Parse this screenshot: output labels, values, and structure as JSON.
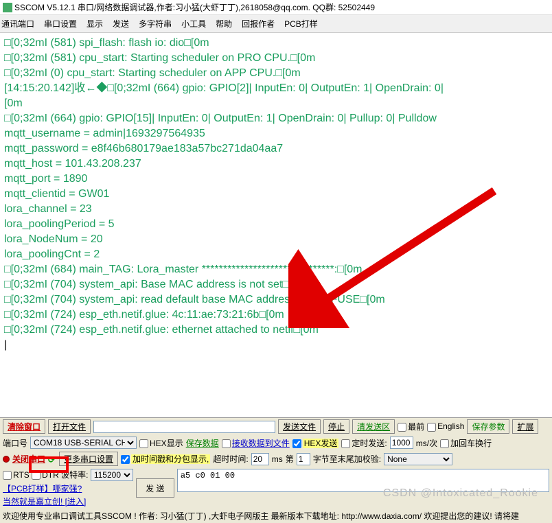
{
  "title": "SSCOM V5.12.1 串口/网络数据调试器,作者:习小猛(大虾丁丁),2618058@qq.com. QQ群: 52502449",
  "menu": [
    "通讯端口",
    "串口设置",
    "显示",
    "发送",
    "多字符串",
    "小工具",
    "帮助",
    "回报作者",
    "PCB打样"
  ],
  "log": [
    {
      "t": "□[0;32mI (581) spi_flash: flash io: dio□[0m"
    },
    {
      "t": "□[0;32mI (581) cpu_start: Starting scheduler on PRO CPU.□[0m"
    },
    {
      "t": "□[0;32mI (0) cpu_start: Starting scheduler on APP CPU.□[0m"
    },
    {
      "t": ""
    },
    {
      "t": "[14:15:20.142]收←◆□[0;32mI (664) gpio: GPIO[2]| InputEn: 0| OutputEn: 1| OpenDrain: 0|"
    },
    {
      "t": "[0m"
    },
    {
      "t": "□[0;32mI (664) gpio: GPIO[15]| InputEn: 0| OutputEn: 1| OpenDrain: 0| Pullup: 0| Pulldow"
    },
    {
      "t": "mqtt_username = admin|1693297564935"
    },
    {
      "t": "mqtt_password = e8f46b680179ae183a57bc271da04aa7"
    },
    {
      "t": "mqtt_host = 101.43.208.237"
    },
    {
      "t": "mqtt_port = 1890"
    },
    {
      "t": "mqtt_clientid = GW01"
    },
    {
      "t": "lora_channel = 23"
    },
    {
      "t": "lora_poolingPeriod = 5"
    },
    {
      "t": "lora_NodeNum = 20"
    },
    {
      "t": "lora_poolingCnt = 2"
    },
    {
      "t": "□[0;32mI (684) main_TAG: Lora_master *******************************:□[0m"
    },
    {
      "t": "□[0;32mI (704) system_api: Base MAC address is not set□[0m"
    },
    {
      "t": "□[0;32mI (704) system_api: read default base MAC address from EFUSE□[0m"
    },
    {
      "t": "□[0;32mI (724) esp_eth.netif.glue: 4c:11:ae:73:21:6b□[0m"
    },
    {
      "t": "□[0;32mI (724) esp_eth.netif.glue: ethernet attached to netif□[0m"
    }
  ],
  "bottom": {
    "clear": "清除窗口",
    "open_file": "打开文件",
    "send_file": "发送文件",
    "stop": "停止",
    "clear_send": "清发送区",
    "topmost": "最前",
    "english": "English",
    "save_params": "保存参数",
    "expand": "扩展",
    "port_label": "端口号",
    "port_value": "COM18 USB-SERIAL CH340",
    "hex_display": "HEX显示",
    "save_data": "保存数据",
    "recv_to_file": "接收数据到文件",
    "hex_send": "HEX发送",
    "timed_send": "定时发送:",
    "timed_value": "1000",
    "ms_unit": "ms/次",
    "add_cr": "加回车换行",
    "close_port": "关闭串口",
    "more_settings": "更多串口设置",
    "timestamp": "加时间戳和分包显示,",
    "timeout_label": "超时时间:",
    "timeout_value": "20",
    "ms": "ms",
    "bytes_label": "第",
    "bytes_value": "1",
    "bytes_suffix": "字节至末尾加校验:",
    "checksum": "None",
    "rts": "RTS",
    "dtr": "DTR",
    "baud_label": "波特率:",
    "baud_value": "115200",
    "send": "发 送",
    "data_value": "a5 c0 01 00",
    "pcb_link": "【PCB打样】哪家强?",
    "jlc": "当然就是嘉立创! [进入]",
    "footer": "欢迎使用专业串口调试工具SSCOM !   作者: 习小猛(丁丁) ,大虾电子网版主   最新版本下载地址: http://www.daxia.com/   欢迎提出您的建议! 请将建"
  },
  "watermark": "CSDN @Intoxicated_Rookie"
}
